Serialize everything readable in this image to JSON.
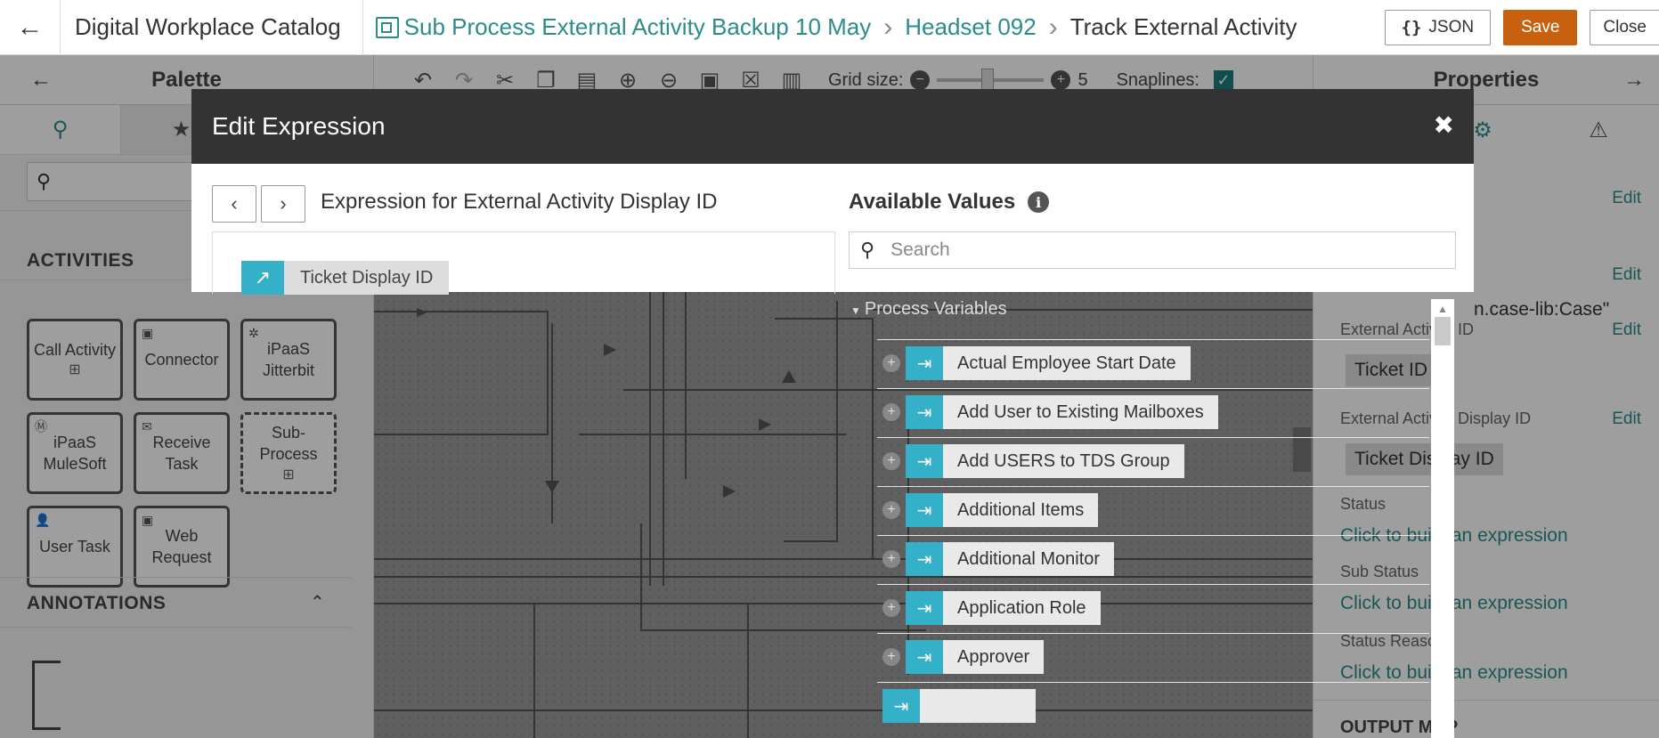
{
  "header": {
    "app_title": "Digital Workplace Catalog",
    "breadcrumbs": [
      "Sub Process External Activity Backup 10 May",
      "Headset 092",
      "Track External Activity"
    ],
    "json_label": "JSON",
    "save_label": "Save",
    "close_label": "Close",
    "colors": {
      "accent": "#2c8c8c",
      "save": "#c7610f"
    }
  },
  "palette": {
    "title": "Palette",
    "activities_title": "ACTIVITIES",
    "annotations_title": "ANNOTATIONS",
    "items": [
      "Call Activity",
      "Connector",
      "iPaaS Jitterbit",
      "iPaaS MuleSoft",
      "Receive Task",
      "Sub-Process",
      "User Task",
      "Web Request"
    ]
  },
  "toolbar": {
    "grid_size_label": "Grid size:",
    "grid_size_value": "5",
    "snaplines_label": "Snaplines:",
    "snaplines_checked": true
  },
  "properties": {
    "title": "Properties",
    "edit_label": "Edit",
    "external_activity_id_label": "External Activity ID",
    "external_activity_id_value": "Ticket ID",
    "external_activity_display_id_label": "External Activity Display ID",
    "external_activity_display_id_value": "Ticket Display ID",
    "type_value": "n.case-lib:Case\"",
    "status_label": "Status",
    "sub_status_label": "Sub Status",
    "status_reason_label": "Status Reason",
    "build_expression_link": "Click to build an expression",
    "output_map_label": "OUTPUT MAP"
  },
  "modal": {
    "title": "Edit Expression",
    "expression_title": "Expression for External Activity Display ID",
    "token_label": "Ticket Display ID",
    "available_values_title": "Available Values",
    "search_placeholder": "Search",
    "group_label": "Process Variables",
    "values": [
      "Actual Employee Start Date",
      "Add User to Existing Mailboxes",
      "Add USERS to TDS Group",
      "Additional Items",
      "Additional Monitor",
      "Application Role",
      "Approver"
    ]
  }
}
